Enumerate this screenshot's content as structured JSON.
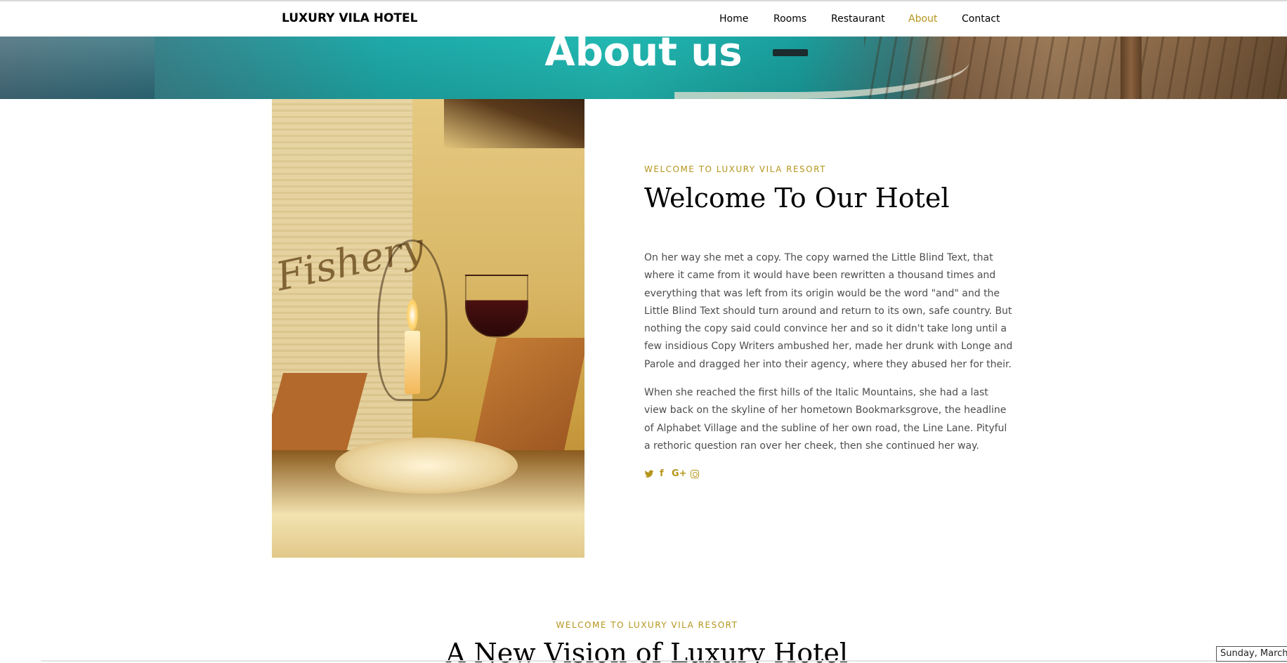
{
  "header": {
    "brand": "LUXURY VILA HOTEL",
    "nav": [
      {
        "label": "Home",
        "active": false
      },
      {
        "label": "Rooms",
        "active": false
      },
      {
        "label": "Restaurant",
        "active": false
      },
      {
        "label": "About",
        "active": true
      },
      {
        "label": "Contact",
        "active": false
      }
    ]
  },
  "hero": {
    "title": "About us"
  },
  "about": {
    "image_sign_text": "Fishery",
    "kicker": "WELCOME TO LUXURY VILA RESORT",
    "heading": "Welcome To Our Hotel",
    "paragraphs": [
      "On her way she met a copy. The copy warned the Little Blind Text, that where it came from it would have been rewritten a thousand times and everything that was left from its origin would be the word \"and\" and the Little Blind Text should turn around and return to its own, safe country. But nothing the copy said could convince her and so it didn't take long until a few insidious Copy Writers ambushed her, made her drunk with Longe and Parole and dragged her into their agency, where they abused her for their.",
      "When she reached the first hills of the Italic Mountains, she had a last view back on the skyline of her hometown Bookmarksgrove, the headline of Alphabet Village and the subline of her own road, the Line Lane. Pityful a rethoric question ran over her cheek, then she continued her way."
    ],
    "social": [
      "twitter-icon",
      "facebook-icon",
      "google-plus-icon",
      "instagram-icon"
    ]
  },
  "vision": {
    "kicker": "WELCOME TO LUXURY VILA RESORT",
    "heading": "A New Vision of Luxury Hotel"
  },
  "date_widget": {
    "text": "Sunday, March"
  },
  "colors": {
    "accent": "#b5951c",
    "text": "#4d4d4d"
  }
}
